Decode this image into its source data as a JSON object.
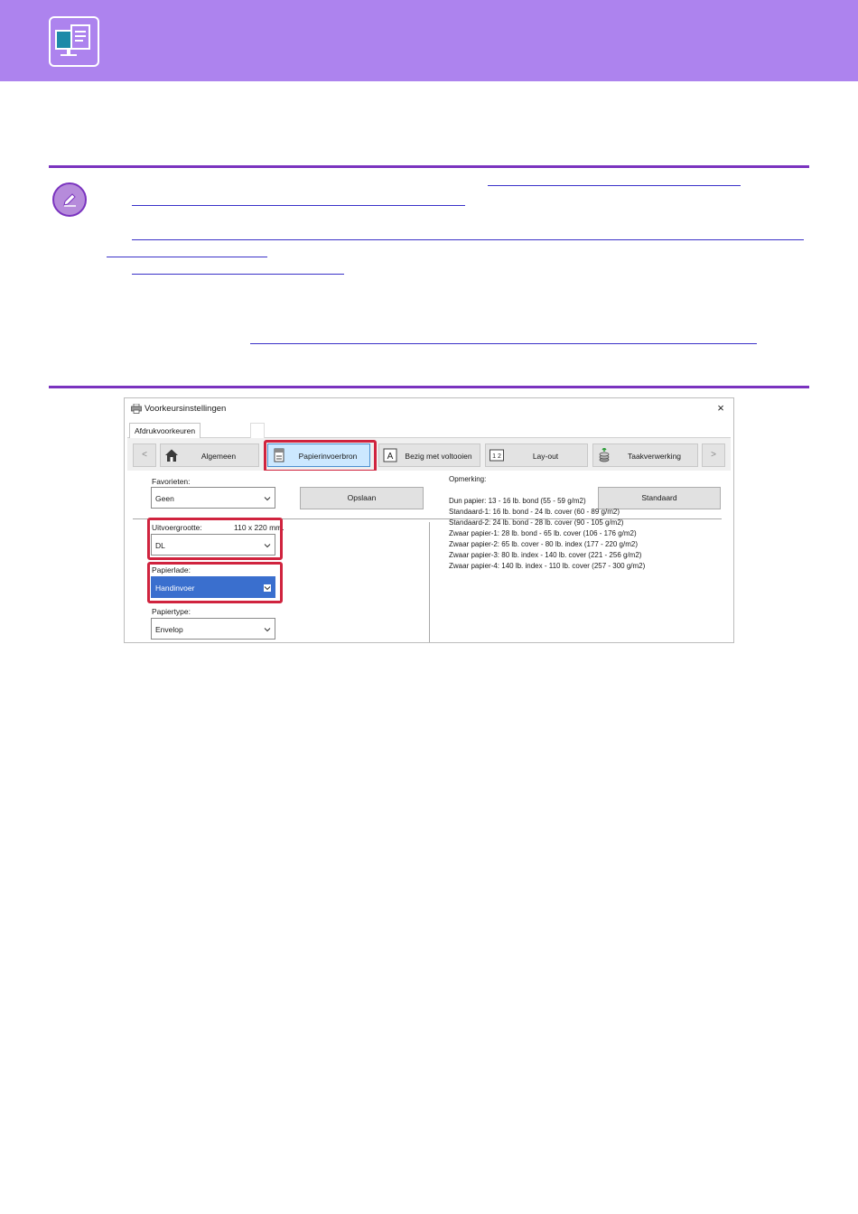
{
  "banner": {
    "icon": "print-computer-icon",
    "color": "#ad83ee"
  },
  "note": {
    "icon": "pencil-note-icon",
    "rule_color": "#7a33bf"
  },
  "dialog": {
    "title": "Voorkeursinstellingen",
    "close": "×",
    "tab": "Afdrukvoorkeuren",
    "nav": {
      "prev": "<",
      "next": ">",
      "buttons": [
        {
          "label": "Algemeen",
          "icon": "house-icon"
        },
        {
          "label": "Papierinvoerbron",
          "icon": "paper-tray-icon"
        },
        {
          "label": "Bezig met voltooien",
          "icon": "letter-a-icon"
        },
        {
          "label": "Lay-out",
          "icon": "layout-1-2-icon"
        },
        {
          "label": "Taakverwerking",
          "icon": "job-stack-icon"
        }
      ]
    },
    "favorites": {
      "label": "Favorieten:",
      "value": "Geen",
      "save": "Opslaan",
      "default": "Standaard"
    },
    "output_size": {
      "label": "Uitvoergrootte:",
      "dimensions": "110 x 220 mm.",
      "value": "DL"
    },
    "paper_tray": {
      "label": "Papierlade:",
      "value": "Handinvoer"
    },
    "paper_type": {
      "label": "Papiertype:",
      "value": "Envelop"
    },
    "remarks": {
      "title": "Opmerking:",
      "lines": [
        "Dun papier: 13 - 16 lb. bond (55 - 59 g/m2)",
        "Standaard-1: 16 lb. bond - 24 lb. cover (60 - 89 g/m2)",
        "Standaard-2: 24 lb. bond - 28 lb. cover (90 - 105 g/m2)",
        "Zwaar papier-1: 28 lb. bond - 65 lb. cover (106 - 176 g/m2)",
        "Zwaar papier-2: 65 lb. cover - 80 lb. index (177 - 220 g/m2)",
        "Zwaar papier-3: 80 lb. index - 140 lb. cover (221 - 256 g/m2)",
        "Zwaar papier-4: 140 lb. index - 110 lb. cover (257 - 300 g/m2)"
      ]
    },
    "highlight_color": "#d0233e",
    "selected_color": "#cce8ff"
  }
}
